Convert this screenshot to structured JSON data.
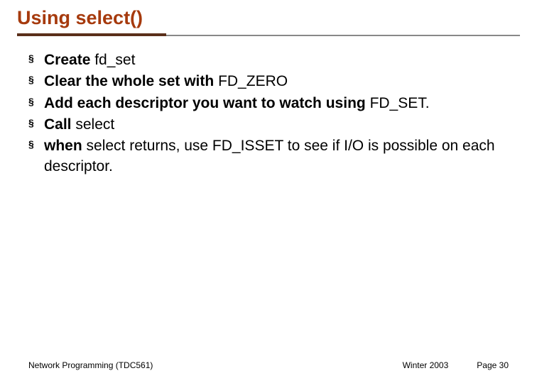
{
  "title": "Using select()",
  "bullets": [
    {
      "bold": "Create ",
      "rest": "fd_set"
    },
    {
      "bold": "Clear the whole set with ",
      "rest": "FD_ZERO"
    },
    {
      "bold": "Add each descriptor you want to watch using ",
      "rest": "FD_SET."
    },
    {
      "bold": "Call ",
      "rest": "select"
    },
    {
      "bold": "when ",
      "rest": "select returns, use FD_ISSET to see if I/O is possible on each descriptor."
    }
  ],
  "footer": {
    "left": "Network Programming (TDC561)",
    "center": "Winter 2003",
    "right": "Page 30"
  }
}
